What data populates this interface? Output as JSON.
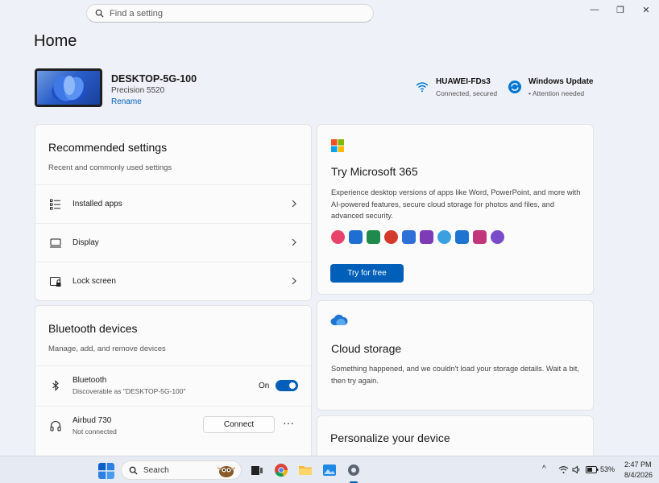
{
  "search": {
    "placeholder": "Find a setting"
  },
  "window_controls": {
    "minimize": "—",
    "maximize": "❐",
    "close": "✕"
  },
  "page": {
    "title": "Home"
  },
  "device": {
    "name": "DESKTOP-5G-100",
    "model": "Precision 5520",
    "rename": "Rename"
  },
  "status": [
    {
      "icon": "wifi-icon",
      "title": "HUAWEI-FDs3",
      "subtitle": "Connected, secured"
    },
    {
      "icon": "windows-update-icon",
      "title": "Windows Update",
      "subtitle": "• Attention needed"
    }
  ],
  "recommended": {
    "title": "Recommended settings",
    "subtitle": "Recent and commonly used settings",
    "items": [
      {
        "label": "Installed apps",
        "icon": "installed-apps-icon"
      },
      {
        "label": "Display",
        "icon": "display-icon"
      },
      {
        "label": "Lock screen",
        "icon": "lock-screen-icon"
      }
    ]
  },
  "bluetooth": {
    "title": "Bluetooth devices",
    "subtitle": "Manage, add, and remove devices",
    "bt_row": {
      "label": "Bluetooth",
      "sub": "Discoverable as \"DESKTOP-5G-100\"",
      "state": "On"
    },
    "device_row": {
      "label": "Airbud 730",
      "sub": "Not connected",
      "button": "Connect",
      "more": "···"
    }
  },
  "m365": {
    "title": "Try Microsoft 365",
    "description": "Experience desktop versions of apps like Word, PowerPoint, and more with AI-powered features, secure cloud storage for photos and files, and advanced security.",
    "button": "Try for free",
    "app_colors": [
      "#e8436a",
      "#1e6fd1",
      "#1f8a4c",
      "#d43a2b",
      "#2e6fd8",
      "#7d3bb5",
      "#3aa0e0",
      "#1f74d1",
      "#c2357a",
      "#7a4cc9"
    ]
  },
  "cloud": {
    "title": "Cloud storage",
    "description": "Something happened, and we couldn't load your storage details. Wait a bit, then try again."
  },
  "personalize": {
    "title": "Personalize your device"
  },
  "taskbar": {
    "search": "Search",
    "tray": {
      "battery": "53%",
      "time": "2:47 PM",
      "date": "8/4/2026",
      "chevron": "^"
    }
  },
  "colors": {
    "accent": "#005fb8",
    "background": "#eef1f8",
    "card": "#fbfbfb"
  }
}
